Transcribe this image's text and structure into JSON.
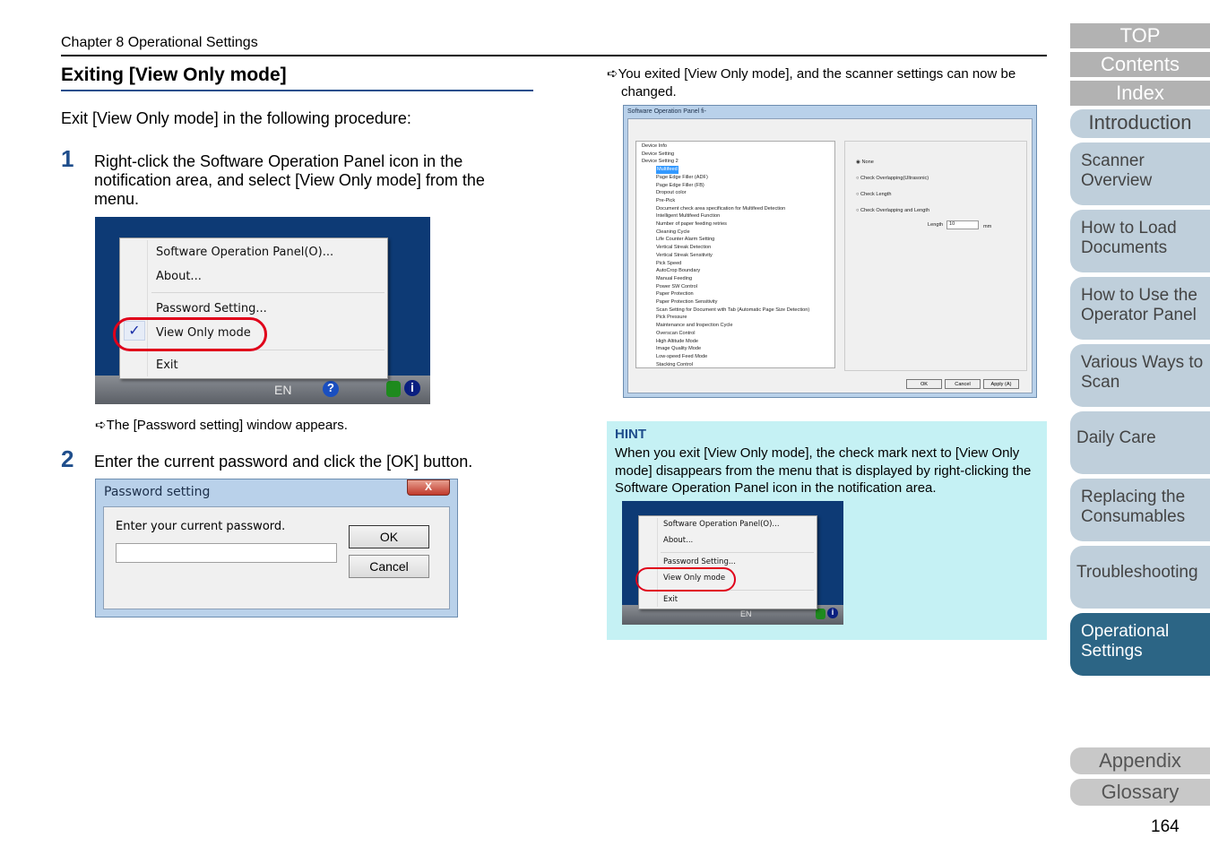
{
  "header": {
    "chapter": "Chapter 8 Operational Settings",
    "page_number": "164"
  },
  "title": "Exiting [View Only mode]",
  "intro": "Exit [View Only mode] in the following procedure:",
  "steps": [
    {
      "num": "1",
      "text": "Right-click the Software Operation Panel icon in the notification area, and select [View Only mode] from the menu.",
      "result": "The [Password setting] window appears."
    },
    {
      "num": "2",
      "text": "Enter the current password and click the [OK] button."
    }
  ],
  "context_menu": {
    "items": [
      "Software Operation Panel(O)...",
      "About...",
      "Password Setting...",
      "View Only mode",
      "Exit"
    ],
    "checked": "View Only mode",
    "tray_lang": "EN"
  },
  "password_dialog": {
    "title": "Password setting",
    "label": "Enter your current password.",
    "ok": "OK",
    "cancel": "Cancel",
    "close": "X",
    "value": ""
  },
  "right_result": "You exited [View Only mode], and the scanner settings can now be changed.",
  "panel": {
    "title": "Software Operation Panel fi-",
    "tree_top": [
      "Device Info",
      "Device Setting",
      "Device Setting 2"
    ],
    "tree_children": [
      "Multifeed",
      "Page Edge Filler (ADF)",
      "Page Edge Filler (FB)",
      "Dropout color",
      "Pre-Pick",
      "Document check area specification for Multifeed Detection",
      "Intelligent Multifeed Function",
      "Number of paper feeding retries",
      "Cleaning Cycle",
      "Life Counter Alarm Setting",
      "Vertical Streak Detection",
      "Vertical Streak Sensitivity",
      "Pick Speed",
      "AutoCrop Boundary",
      "Manual Feeding",
      "Power SW Control",
      "Paper Protection",
      "Paper Protection Sensitivity",
      "Scan Setting for Document with Tab (Automatic Page Size Detection)",
      "Pick Pressure",
      "Maintenance and Inspection Cycle",
      "Overscan Control",
      "High Altitude Mode",
      "Image Quality Mode",
      "Low-speed Feed Mode",
      "Stacking Control"
    ],
    "selected": "Multifeed",
    "options": [
      "None",
      "Check Overlapping(Ultrasonic)",
      "Check Length",
      "Check Overlapping and Length"
    ],
    "selected_option": "None",
    "length_label": "Length",
    "length_value": "10",
    "length_unit": "mm",
    "buttons": [
      "OK",
      "Cancel",
      "Apply (A)"
    ]
  },
  "hint": {
    "heading": "HINT",
    "text": "When you exit [View Only mode], the check mark next to [View Only mode] disappears from the menu that is displayed by right-clicking the Software Operation Panel icon in the notification area."
  },
  "sidebar": {
    "top": [
      "TOP",
      "Contents",
      "Index"
    ],
    "tabs": [
      "Introduction",
      "Scanner Overview",
      "How to Load Documents",
      "How to Use the Operator Panel",
      "Various Ways to Scan",
      "Daily Care",
      "Replacing the Consumables",
      "Troubleshooting",
      "Operational Settings"
    ],
    "active": "Operational Settings",
    "bottom": [
      "Appendix",
      "Glossary"
    ]
  },
  "colors": {
    "accent": "#1f4e8c",
    "hint_bg": "#c5f1f4",
    "tab_bg": "#bfcfdb",
    "tab_active": "#2c6585",
    "highlight": "#e0001a"
  }
}
